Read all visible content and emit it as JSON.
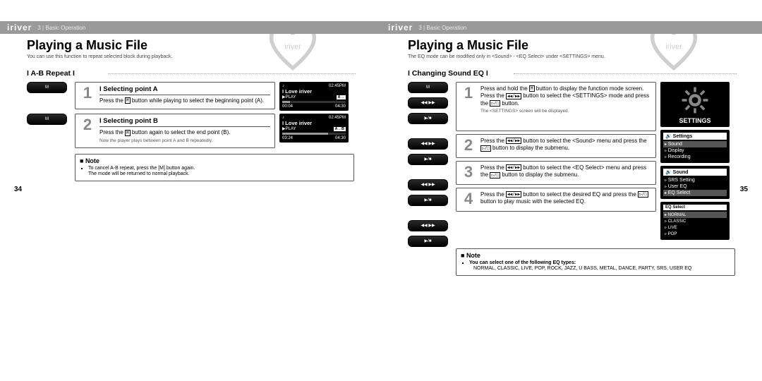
{
  "brand": "iriver",
  "breadcrumb": "3 | Basic Operation",
  "left": {
    "title": "Playing a Music File",
    "subtitle": "You can use this function to repeat selected block during playback.",
    "section_title": "I A-B Repeat I",
    "pagenum": "34",
    "steps": [
      {
        "num": "1",
        "button_label": "M",
        "title": "I Selecting point A",
        "desc_pre": "Press the ",
        "desc_btn": "M",
        "desc_post": " button while playing to select the beginning point (A)."
      },
      {
        "num": "2",
        "button_label": "M",
        "title": "I Selecting point B",
        "desc_pre": "Press the ",
        "desc_btn": "M",
        "desc_post": " button again to select the end point (B).",
        "tiny": "Now the player plays between point A and B repeatedly."
      }
    ],
    "screens": [
      {
        "clock": "02:45PM",
        "track": "I Love iriver",
        "status": "▶PLAY",
        "ab": "A→",
        "time_l": "00:04",
        "time_r": "04:30",
        "fillpct": 12
      },
      {
        "clock": "02:45PM",
        "track": "I Love iriver",
        "status": "▶PLAY",
        "ab": "A↔B",
        "time_l": "03:24",
        "time_r": "04:30",
        "fillpct": 72
      }
    ],
    "note": {
      "head": "Note",
      "items": [
        "To cancel A-B repeat, press the [M] button again.",
        "The mode will be returned to normal playback."
      ]
    }
  },
  "right": {
    "title": "Playing a Music File",
    "subtitle": "The EQ mode can be modified only in <Sound> - <EQ Select> under <SETTINGS> menu.",
    "section_title": "I Changing Sound EQ I",
    "pagenum": "35",
    "button_stack": [
      "M",
      "◀◀  ▶▶",
      "▶/■",
      "◀◀  ▶▶",
      "▶/■",
      "◀◀  ▶▶",
      "▶/■",
      "◀◀  ▶▶",
      "▶/■"
    ],
    "steps": [
      {
        "num": "1",
        "line1_pre": "Press and hold the ",
        "line1_btn": "M",
        "line1_post": " button to display the function mode screen.",
        "line2_pre": "Press the ",
        "line2_btn": "◀◀/▶▶",
        "line2_mid": " button to select the <SETTINGS> mode and press the ",
        "line2_btn2": "▷/□",
        "line2_post": " button.",
        "tiny": "The <SETTINGS> screen will be displayed."
      },
      {
        "num": "2",
        "line1_pre": "Press the ",
        "line1_btn": "◀◀/▶▶",
        "line1_mid": " button to select the <Sound> menu and press the ",
        "line1_btn2": "▷/□",
        "line1_post": " button to display the submenu."
      },
      {
        "num": "3",
        "line1_pre": "Press the ",
        "line1_btn": "◀◀/▶▶",
        "line1_mid": " button to select the <EQ Select> menu and press the ",
        "line1_btn2": "▷/□",
        "line1_post": " button to display the submenu."
      },
      {
        "num": "4",
        "line1_pre": "Press the ",
        "line1_btn": "◀◀/▶▶",
        "line1_mid": " button to select the desired EQ and press the ",
        "line1_btn2": "▷/□",
        "line1_post": " button to play music with the selected EQ."
      }
    ],
    "screens": [
      {
        "type": "settings",
        "label": "SETTINGS"
      },
      {
        "type": "menu",
        "title": "Settings",
        "items": [
          "Sound",
          "Display",
          "Recording"
        ],
        "sel": 0
      },
      {
        "type": "menu",
        "title": "Sound",
        "items": [
          "SRS Setting",
          "User EQ",
          "EQ Select"
        ],
        "sel": 2
      },
      {
        "type": "menu",
        "title": "EQ Select",
        "items": [
          "NORMAL",
          "CLASSIC",
          "LIVE",
          "POP"
        ],
        "sel": 0,
        "small": true
      }
    ],
    "note": {
      "head": "Note",
      "strong": "You can select one of the following EQ types:",
      "items": [
        "NORMAL, CLASSIC, LIVE, POP, ROCK, JAZZ, U BASS, METAL, DANCE, PARTY, SRS, USER EQ"
      ]
    }
  }
}
